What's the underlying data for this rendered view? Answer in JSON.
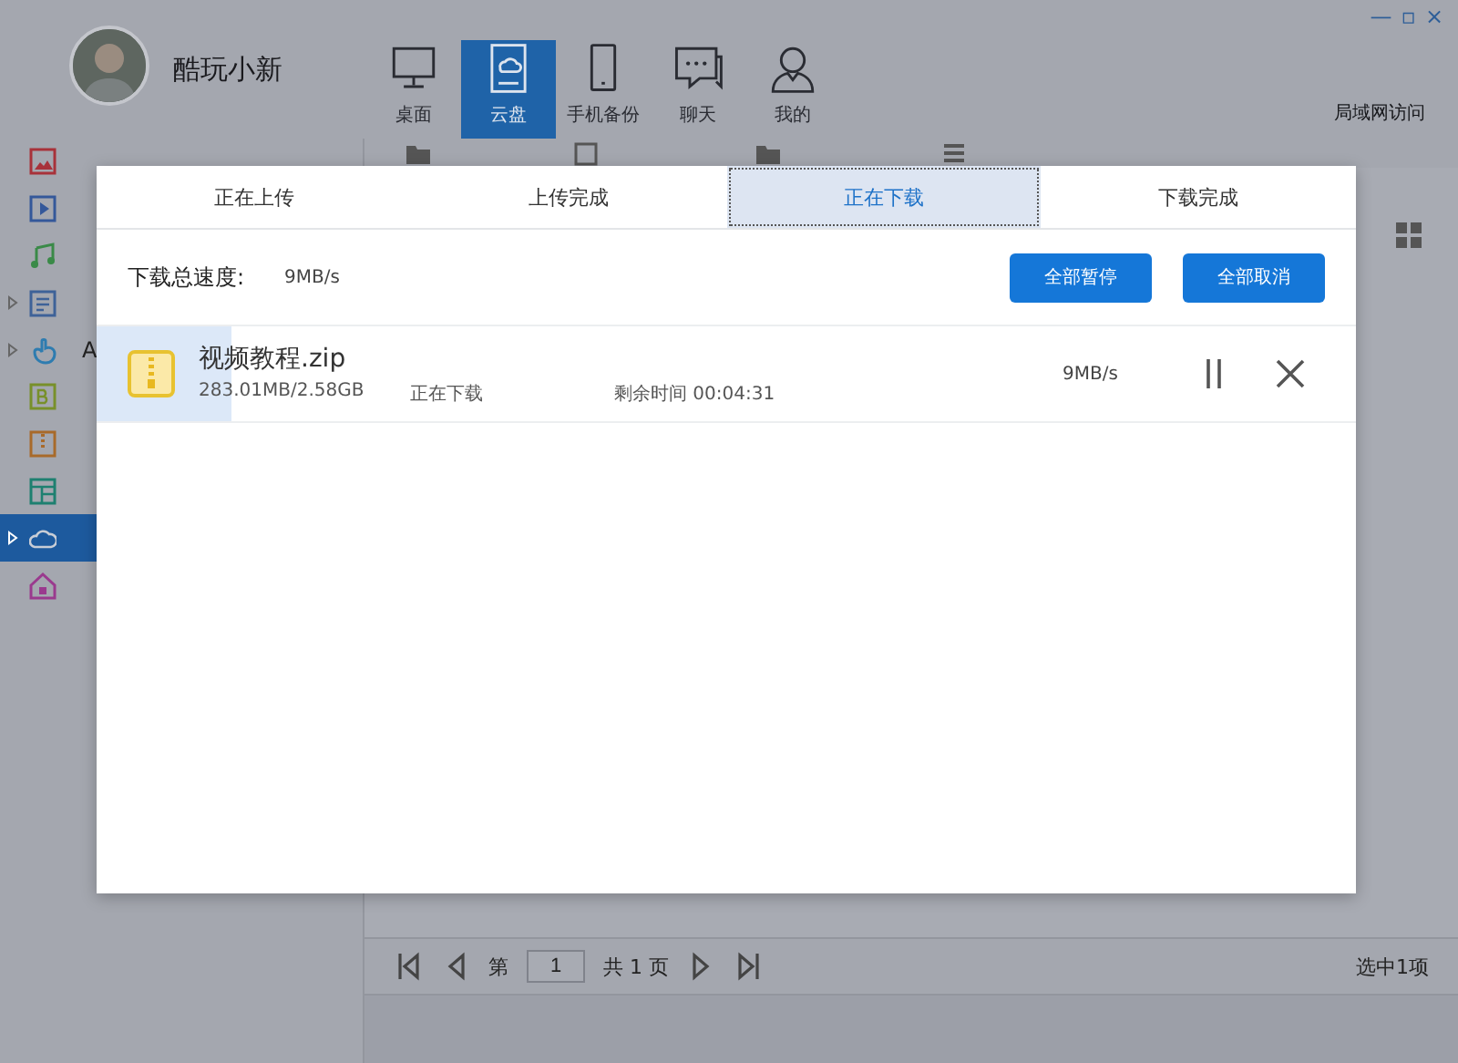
{
  "header": {
    "user_name": "酷玩小新",
    "window_controls": [
      "—",
      "▫",
      "×"
    ],
    "nav": [
      {
        "label": "桌面",
        "kind": "monitor",
        "selected": false
      },
      {
        "label": "云盘",
        "kind": "cloud",
        "selected": true
      },
      {
        "label": "手机备份",
        "kind": "phone",
        "selected": false
      },
      {
        "label": "聊天",
        "kind": "chat",
        "selected": false
      },
      {
        "label": "我的",
        "kind": "user",
        "selected": false
      }
    ],
    "lan_access": "局域网访问"
  },
  "sidebar": {
    "items": [
      {
        "kind": "photo",
        "color": "#a8323a",
        "collapsed": false,
        "selected": false
      },
      {
        "kind": "video",
        "color": "#34589a",
        "collapsed": false,
        "selected": false
      },
      {
        "kind": "music",
        "color": "#3a8a48",
        "collapsed": false,
        "selected": false
      },
      {
        "kind": "doc",
        "color": "#3e6298",
        "collapsed": true,
        "selected": false
      },
      {
        "label": "A",
        "kind": "hand",
        "color": "#2e7cb0",
        "collapsed": true,
        "selected": false
      },
      {
        "kind": "letter",
        "color": "#78902a",
        "collapsed": false,
        "selected": false
      },
      {
        "kind": "zip",
        "color": "#a86a2a",
        "collapsed": false,
        "selected": false
      },
      {
        "kind": "grid",
        "color": "#1e8070",
        "collapsed": false,
        "selected": false
      },
      {
        "kind": "cloud",
        "color": "#c8cdd6",
        "collapsed": true,
        "selected": true
      },
      {
        "kind": "home",
        "color": "#9a3a8e",
        "collapsed": false,
        "selected": false
      }
    ]
  },
  "pagination": {
    "page_prefix": "第",
    "page": "1",
    "total": "共 1 页",
    "selection": "选中1项"
  },
  "dialog": {
    "tabs": [
      {
        "label": "正在上传",
        "selected": false
      },
      {
        "label": "上传完成",
        "selected": false
      },
      {
        "label": "正在下载",
        "selected": true
      },
      {
        "label": "下载完成",
        "selected": false
      }
    ],
    "speed_label": "下载总速度:",
    "speed": "9MB/s",
    "buttons": [
      "全部暂停",
      "全部取消"
    ],
    "downloads": [
      {
        "name": "视频教程.zip",
        "size": "283.01MB/2.58GB",
        "status": "正在下载",
        "remaining": "剩余时间 00:04:31",
        "speed": "9MB/s",
        "level": 0.107
      }
    ]
  }
}
